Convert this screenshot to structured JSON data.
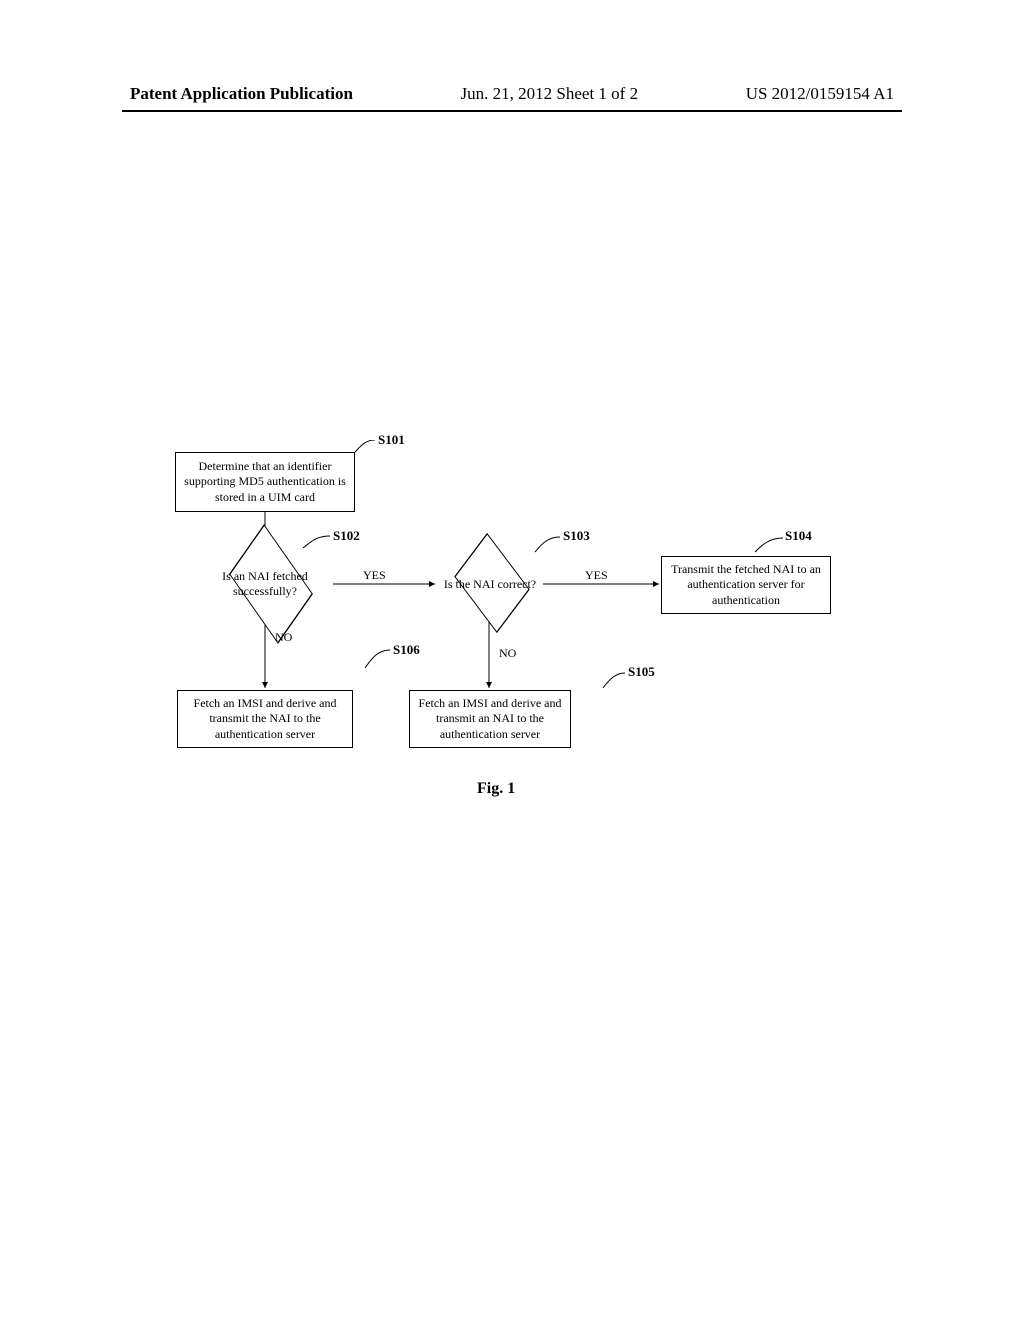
{
  "header": {
    "left": "Patent Application Publication",
    "center": "Jun. 21, 2012  Sheet 1 of 2",
    "right": "US 2012/0159154 A1"
  },
  "flow": {
    "s101": {
      "label": "S101",
      "text": "Determine that an identifier supporting MD5 authentication is stored in a UIM card"
    },
    "s102": {
      "label": "S102",
      "text": "Is an NAI fetched successfully?"
    },
    "s103": {
      "label": "S103",
      "text": "Is the NAI correct?"
    },
    "s104": {
      "label": "S104",
      "text": "Transmit the fetched NAI to an authentication server for authentication"
    },
    "s105": {
      "label": "S105",
      "text": "Fetch an IMSI and derive and transmit an NAI to the authentication server"
    },
    "s106": {
      "label": "S106",
      "text": "Fetch an IMSI and derive and transmit the NAI to the authentication server"
    },
    "yes": "YES",
    "no": "NO"
  },
  "caption": "Fig. 1"
}
